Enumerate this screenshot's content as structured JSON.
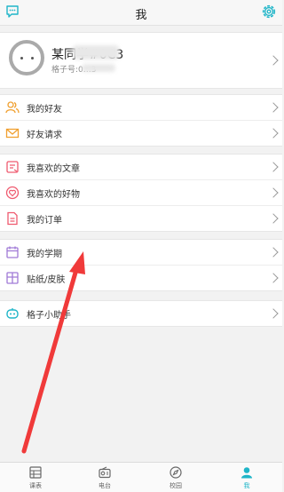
{
  "header": {
    "title": "我"
  },
  "profile": {
    "name": "某同学#0C3",
    "id_text": "格子号:0…3"
  },
  "menu": {
    "group1": [
      {
        "label": "我的好友",
        "icon": "friends-icon"
      },
      {
        "label": "好友请求",
        "icon": "mail-icon"
      }
    ],
    "group2": [
      {
        "label": "我喜欢的文章",
        "icon": "article-icon"
      },
      {
        "label": "我喜欢的好物",
        "icon": "heart-icon"
      },
      {
        "label": "我的订单",
        "icon": "order-icon"
      }
    ],
    "group3": [
      {
        "label": "我的学期",
        "icon": "calendar-icon"
      },
      {
        "label": "贴纸/皮肤",
        "icon": "sticker-icon"
      }
    ],
    "group4": [
      {
        "label": "格子小助手",
        "icon": "robot-icon"
      }
    ]
  },
  "tabs": [
    {
      "label": "课表",
      "icon": "timetable-icon"
    },
    {
      "label": "电台",
      "icon": "radio-icon"
    },
    {
      "label": "校园",
      "icon": "compass-icon"
    },
    {
      "label": "我",
      "icon": "person-icon",
      "active": true
    }
  ],
  "colors": {
    "accent": "#1fb5c8",
    "annotation_arrow": "#f03a3a"
  }
}
